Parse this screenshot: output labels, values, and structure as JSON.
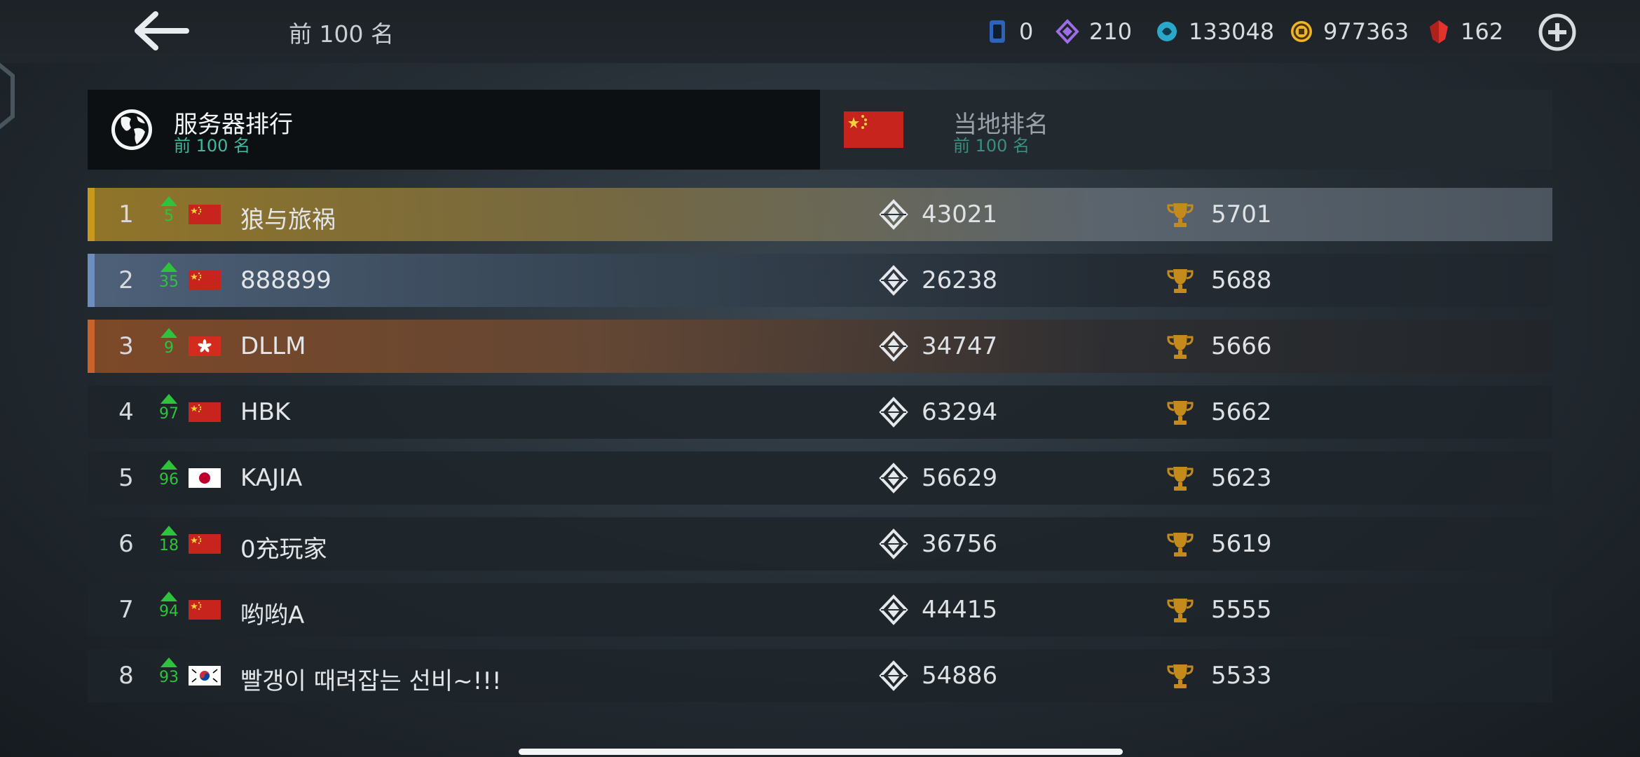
{
  "header": {
    "title": "前 100 名",
    "currencies": [
      {
        "icon": "card-icon",
        "value": "0",
        "color": "#3a7bd5"
      },
      {
        "icon": "diamond-token-icon",
        "value": "210",
        "color": "#9b6ee6"
      },
      {
        "icon": "swirl-token-icon",
        "value": "133048",
        "color": "#2aa7c9"
      },
      {
        "icon": "coin-icon",
        "value": "977363",
        "color": "#f0b429"
      },
      {
        "icon": "ruby-icon",
        "value": "162",
        "color": "#e0342c"
      }
    ]
  },
  "tabs": {
    "server": {
      "title": "服务器排行",
      "subtitle": "前 100 名"
    },
    "local": {
      "title": "当地排名",
      "subtitle": "前 100 名"
    }
  },
  "rows": [
    {
      "rank": "1",
      "delta": "5",
      "flag": "cn",
      "name": "狼与旅祸",
      "score": "43021",
      "trophies": "5701",
      "tier": "gold"
    },
    {
      "rank": "2",
      "delta": "35",
      "flag": "cn",
      "name": "888899",
      "score": "26238",
      "trophies": "5688",
      "tier": "silver"
    },
    {
      "rank": "3",
      "delta": "9",
      "flag": "hk",
      "name": "DLLM",
      "score": "34747",
      "trophies": "5666",
      "tier": "bronze"
    },
    {
      "rank": "4",
      "delta": "97",
      "flag": "cn",
      "name": "HBK",
      "score": "63294",
      "trophies": "5662",
      "tier": "none"
    },
    {
      "rank": "5",
      "delta": "96",
      "flag": "jp",
      "name": "KAJIA",
      "score": "56629",
      "trophies": "5623",
      "tier": "none"
    },
    {
      "rank": "6",
      "delta": "18",
      "flag": "cn",
      "name": "0充玩家",
      "score": "36756",
      "trophies": "5619",
      "tier": "none"
    },
    {
      "rank": "7",
      "delta": "94",
      "flag": "cn",
      "name": "哟哟A",
      "score": "44415",
      "trophies": "5555",
      "tier": "none"
    },
    {
      "rank": "8",
      "delta": "93",
      "flag": "kr",
      "name": "빨갱이 때려잡는 선비~!!!",
      "score": "54886",
      "trophies": "5533",
      "tier": "none"
    }
  ],
  "colors": {
    "accent_teal": "#3fb8a0",
    "rank_up_green": "#2fc23c",
    "gold_stripe": "#c9981f",
    "silver_stripe": "#6d8fbf",
    "bronze_stripe": "#c8642a",
    "trophy": "#c58a1c"
  }
}
